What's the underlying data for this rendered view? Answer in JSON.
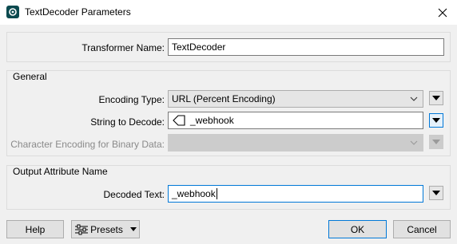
{
  "window": {
    "title": "TextDecoder Parameters"
  },
  "transformer": {
    "label": "Transformer Name:",
    "value": "TextDecoder"
  },
  "general": {
    "group_label": "General",
    "encoding_type_label": "Encoding Type:",
    "encoding_type_value": "URL (Percent Encoding)",
    "string_to_decode_label": "String to Decode:",
    "string_to_decode_value": "_webhook",
    "char_encoding_label": "Character Encoding for Binary Data:",
    "char_encoding_value": ""
  },
  "output": {
    "group_label": "Output Attribute Name",
    "decoded_text_label": "Decoded Text:",
    "decoded_text_value": "_webhook"
  },
  "footer": {
    "help_label": "Help",
    "presets_label": "Presets",
    "ok_label": "OK",
    "cancel_label": "Cancel"
  },
  "colors": {
    "accent": "#0078d7",
    "app_icon": "#0b4a4f"
  }
}
